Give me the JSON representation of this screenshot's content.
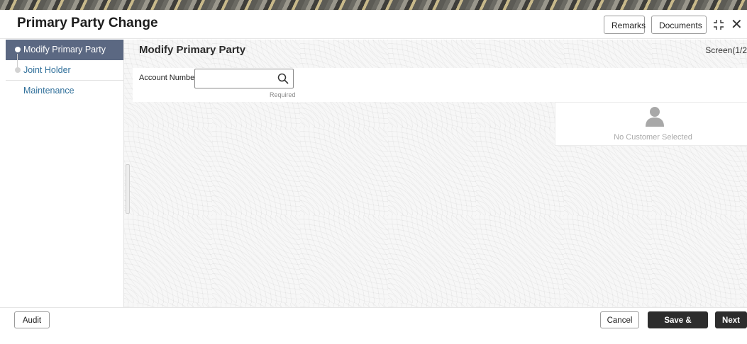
{
  "header": {
    "title": "Primary Party Change",
    "remarks_label": "Remarks",
    "documents_label": "Documents",
    "close_symbol": "✕"
  },
  "sidebar": {
    "steps": [
      {
        "label": "Modify Primary Party",
        "active": true
      },
      {
        "label": "Joint Holder Maintenance",
        "active": false
      }
    ]
  },
  "main": {
    "section_title": "Modify Primary Party",
    "screen_indicator": "Screen(1/2",
    "account_number": {
      "label": "Account Number",
      "value": "",
      "helper": "Required"
    },
    "customer_card": {
      "empty_text": "No Customer Selected"
    }
  },
  "footer": {
    "audit_label": "Audit",
    "cancel_label": "Cancel",
    "save_close_label": "Save & Close",
    "next_label": "Next"
  },
  "icons": {
    "search": "search-icon",
    "maximize": "maximize-icon",
    "close": "close-icon",
    "avatar": "user-avatar-icon"
  },
  "colors": {
    "active_step_bg": "#5b6882",
    "inactive_step_text": "#2f6f9a",
    "primary_button": "#2d2d2d"
  }
}
